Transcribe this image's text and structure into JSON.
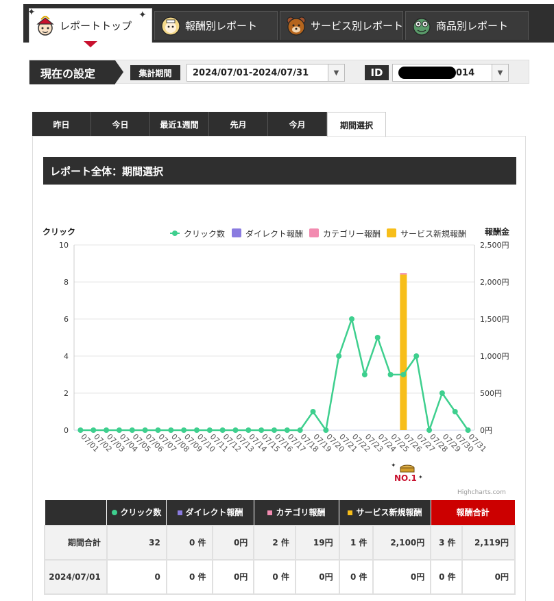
{
  "top_tabs": [
    {
      "label": "レポートトップ",
      "icon": "samurai-icon",
      "active": true
    },
    {
      "label": "報酬別レポート",
      "icon": "girl-avatar-icon",
      "active": false
    },
    {
      "label": "サービス別レポート",
      "icon": "bear-icon",
      "active": false
    },
    {
      "label": "商品別レポート",
      "icon": "frog-icon",
      "active": false
    }
  ],
  "settings": {
    "title": "現在の設定",
    "period_label": "集計期間",
    "period_value": "2024/07/01-2024/07/31",
    "id_label": "ID",
    "id_value_suffix": "014"
  },
  "period_tabs": [
    "昨日",
    "今日",
    "最近1週間",
    "先月",
    "今月",
    "期間選択"
  ],
  "active_period_tab": "期間選択",
  "report_title": "レポート全体：期間選択",
  "credits": "Highcharts.com",
  "badge": "NO.1",
  "colors": {
    "click": "#3ecf8e",
    "direct": "#8a7be0",
    "category": "#f28bb0",
    "service": "#f7be1a",
    "total_header": "#cc0000"
  },
  "chart_data": {
    "type": "line",
    "y_left_label": "クリック",
    "y_right_label": "報酬金",
    "y_left_ticks": [
      "10",
      "8",
      "6",
      "4",
      "2",
      "0"
    ],
    "y_right_ticks": [
      "2,500円",
      "2,000円",
      "1,500円",
      "1,000円",
      "500円",
      "0円"
    ],
    "ylim_left": [
      0,
      10
    ],
    "ylim_right": [
      0,
      2500
    ],
    "legend_position": "top-right",
    "categories": [
      "07/01",
      "07/02",
      "07/03",
      "07/04",
      "07/05",
      "07/06",
      "07/07",
      "07/08",
      "07/09",
      "07/10",
      "07/11",
      "07/12",
      "07/13",
      "07/14",
      "07/15",
      "07/16",
      "07/17",
      "07/18",
      "07/19",
      "07/20",
      "07/21",
      "07/22",
      "07/23",
      "07/24",
      "07/25",
      "07/26",
      "07/27",
      "07/28",
      "07/29",
      "07/30",
      "07/31"
    ],
    "series": [
      {
        "name": "クリック数",
        "type": "line",
        "values": [
          0,
          0,
          0,
          0,
          0,
          0,
          0,
          0,
          0,
          0,
          0,
          0,
          0,
          0,
          0,
          0,
          0,
          0,
          1,
          0,
          4,
          6,
          3,
          5,
          3,
          3,
          4,
          0,
          2,
          1,
          0
        ]
      },
      {
        "name": "ダイレクト報酬",
        "type": "bar",
        "values": [
          0,
          0,
          0,
          0,
          0,
          0,
          0,
          0,
          0,
          0,
          0,
          0,
          0,
          0,
          0,
          0,
          0,
          0,
          0,
          0,
          0,
          0,
          0,
          0,
          0,
          0,
          0,
          0,
          0,
          0,
          0
        ]
      },
      {
        "name": "カテゴリー報酬",
        "type": "bar",
        "values": [
          0,
          0,
          0,
          0,
          0,
          0,
          0,
          0,
          0,
          0,
          0,
          0,
          0,
          0,
          0,
          0,
          0,
          0,
          0,
          0,
          0,
          0,
          0,
          0,
          0,
          19,
          0,
          0,
          0,
          0,
          0
        ]
      },
      {
        "name": "サービス新規報酬",
        "type": "bar",
        "values": [
          0,
          0,
          0,
          0,
          0,
          0,
          0,
          0,
          0,
          0,
          0,
          0,
          0,
          0,
          0,
          0,
          0,
          0,
          0,
          0,
          0,
          0,
          0,
          0,
          0,
          2100,
          0,
          0,
          0,
          0,
          0
        ]
      }
    ]
  },
  "table": {
    "headers": [
      "クリック数",
      "ダイレクト報酬",
      "カテゴリ報酬",
      "サービス新規報酬",
      "報酬合計"
    ],
    "rows": [
      {
        "label": "期間合計",
        "clicks": "32",
        "direct_n": "0 件",
        "direct_y": "0円",
        "cat_n": "2 件",
        "cat_y": "19円",
        "svc_n": "1 件",
        "svc_y": "2,100円",
        "tot_n": "3 件",
        "tot_y": "2,119円"
      },
      {
        "label": "2024/07/01",
        "clicks": "0",
        "direct_n": "0 件",
        "direct_y": "0円",
        "cat_n": "0 件",
        "cat_y": "0円",
        "svc_n": "0 件",
        "svc_y": "0円",
        "tot_n": "0 件",
        "tot_y": "0円"
      }
    ]
  }
}
